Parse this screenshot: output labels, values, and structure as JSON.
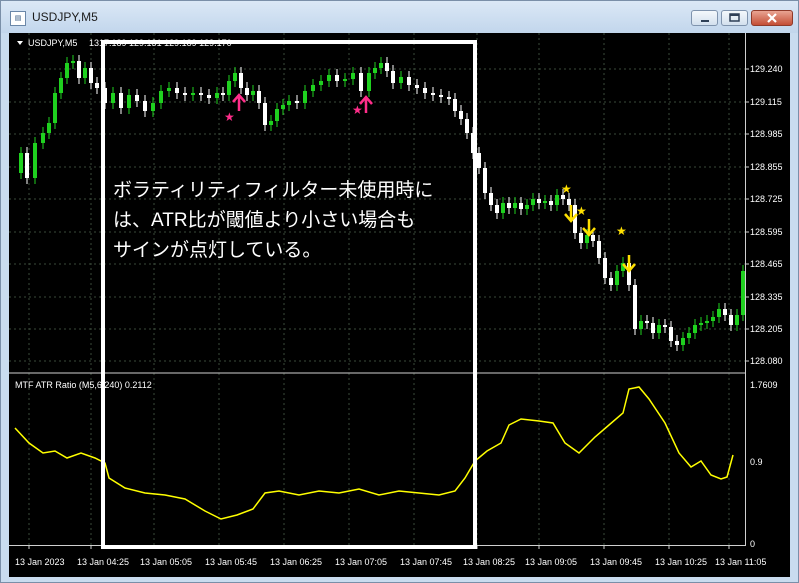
{
  "window": {
    "title": "USDJPY,M5",
    "icon": "chart-window-icon"
  },
  "chart": {
    "label": "USDJPY,M5",
    "ohlc_text": "1317.189 129.131 129.189 129.170",
    "price_ticks": [
      "129.240",
      "129.115",
      "128.985",
      "128.855",
      "128.725",
      "128.595",
      "128.465",
      "128.335",
      "128.205",
      "128.080"
    ],
    "time_ticks": [
      "13 Jan 2023",
      "13 Jan 04:25",
      "13 Jan 05:05",
      "13 Jan 05:45",
      "13 Jan 06:25",
      "13 Jan 07:05",
      "13 Jan 07:45",
      "13 Jan 08:25",
      "13 Jan 09:05",
      "13 Jan 09:45",
      "13 Jan 10:25",
      "13 Jan 11:05"
    ]
  },
  "indicator": {
    "label": "MTF ATR Ratio (M5,6,240) 0.2112",
    "axis_ticks": [
      "1.7609",
      "0.9",
      "0"
    ]
  },
  "annotation": {
    "lines": [
      "ボラティリティフィルター未使用時に",
      "は、ATR比が閾値より小さい場合も",
      "サインが点灯している。"
    ]
  },
  "colors": {
    "bull": "#1fd11f",
    "bear": "#ffffff",
    "indicator": "#ffff00",
    "buy_signal": "#ff2d8a",
    "sell_signal": "#ffe000",
    "highlight": "#ffffff"
  }
}
